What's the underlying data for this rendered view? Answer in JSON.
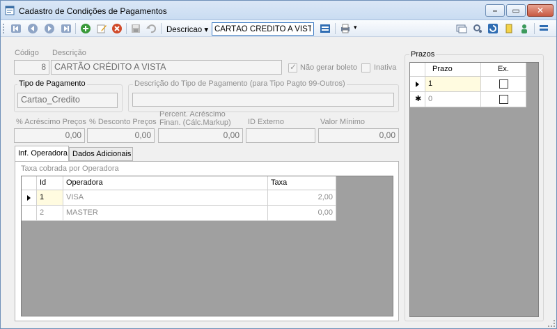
{
  "window": {
    "title": "Cadastro de Condições de Pagamentos"
  },
  "toolbar": {
    "search_field_label": "Descricao",
    "search_value": "CARTÃO CRÉDITO A VISTA",
    "dropdown_glyph": "▾"
  },
  "form": {
    "codigo_label": "Código",
    "codigo_value": "8",
    "descricao_label": "Descrição",
    "descricao_value": "CARTÃO CRÉDITO A VISTA",
    "nao_gerar_boleto_label": "Não gerar boleto",
    "nao_gerar_boleto_checked": true,
    "inativa_label": "Inativa",
    "inativa_checked": false,
    "tipo_pagamento_group": "Tipo de Pagamento",
    "tipo_pagamento_value": "Cartao_Credito",
    "desc_tipo_group": "Descrição do Tipo de Pagamento (para Tipo Pagto 99-Outros)",
    "desc_tipo_value": "",
    "acrescimo_precos_label": "% Acréscimo Preços",
    "acrescimo_precos_value": "0,00",
    "desconto_precos_label": "% Desconto Preços",
    "desconto_precos_value": "0,00",
    "percent_acrescimo_label_1": "Percent. Acréscimo",
    "percent_acrescimo_label_2": "Finan. (Cálc.Markup)",
    "percent_acrescimo_value": "0,00",
    "id_externo_label": "ID Externo",
    "id_externo_value": "",
    "valor_minimo_label": "Valor Mínimo",
    "valor_minimo_value": "0,00"
  },
  "tabs": [
    {
      "label": "Inf. Operadora",
      "active": true
    },
    {
      "label": "Dados Adicionais",
      "active": false
    }
  ],
  "operadora": {
    "caption": "Taxa cobrada por Operadora",
    "columns": [
      "Id",
      "Operadora",
      "Taxa"
    ],
    "rows": [
      {
        "id": "1",
        "operadora": "VISA",
        "taxa": "2,00"
      },
      {
        "id": "2",
        "operadora": "MASTER",
        "taxa": "0,00"
      }
    ]
  },
  "prazos": {
    "title": "Prazos",
    "columns": [
      "Prazo",
      "Ex."
    ],
    "rows": [
      {
        "prazo": "1",
        "ex": false
      },
      {
        "prazo": "0",
        "ex": false
      }
    ],
    "new_row_glyph": "✱"
  },
  "colors": {
    "title_bar": "#c9dcf2",
    "grid_background": "#a0a0a0",
    "current_cell": "#fffbe0",
    "search_border": "#3d7bc2"
  }
}
